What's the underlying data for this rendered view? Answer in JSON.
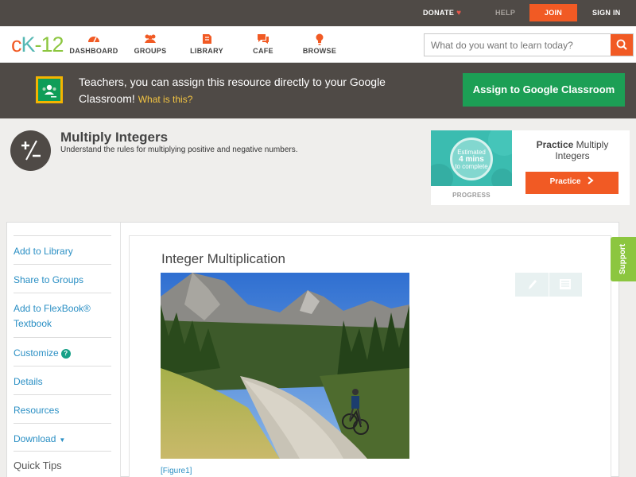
{
  "topbar": {
    "donate": "DONATE",
    "help": "HELP",
    "join": "JOIN",
    "sign_in": "SIGN IN"
  },
  "brand": {
    "logo_c": "c",
    "logo_k": "K",
    "logo_n": "-12"
  },
  "nav": {
    "items": [
      {
        "label": "DASHBOARD",
        "icon": "dashboard-icon"
      },
      {
        "label": "GROUPS",
        "icon": "groups-icon"
      },
      {
        "label": "LIBRARY",
        "icon": "library-icon"
      },
      {
        "label": "CAFE",
        "icon": "cafe-icon"
      },
      {
        "label": "BROWSE",
        "icon": "browse-icon"
      }
    ],
    "search_placeholder": "What do you want to learn today?"
  },
  "banner": {
    "text": "Teachers, you can assign this resource directly to your Google Classroom!",
    "what_link": "What is this?",
    "assign_button": "Assign to Google Classroom"
  },
  "concept": {
    "title": "Multiply Integers",
    "subtitle": "Understand the rules for multiplying positive and negative numbers."
  },
  "practice": {
    "estimated": "Estimated",
    "mins": "4 mins",
    "to_complete": "to complete",
    "progress_label": "PROGRESS",
    "title_bold": "Practice",
    "title_rest": "Multiply Integers",
    "button": "Practice"
  },
  "sidebar": {
    "items": [
      "Add to Library",
      "Share to Groups",
      "Add to FlexBook® Textbook",
      "Customize",
      "Details",
      "Resources",
      "Download"
    ],
    "quick_tips": "Quick Tips"
  },
  "content": {
    "title": "Integer Multiplication",
    "figure_caption": "[Figure1]"
  },
  "support": "Support",
  "colors": {
    "accent": "#f15a24",
    "dark": "#4f4a46",
    "link": "#2a8fc4",
    "green": "#1c9f55"
  }
}
